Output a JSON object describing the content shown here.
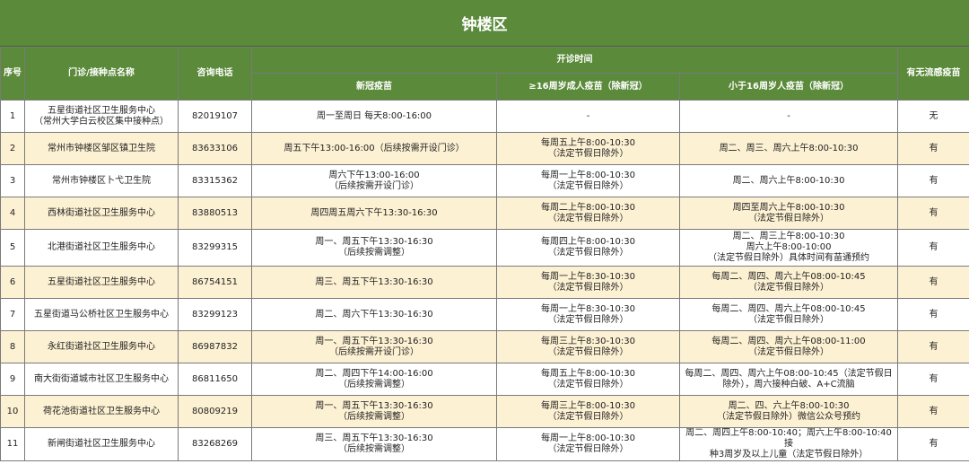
{
  "title": "钟楼区",
  "headers": {
    "seq": "序号",
    "name": "门诊/接种点名称",
    "phone": "咨询电话",
    "hours": "开诊时间",
    "covid": "新冠疫苗",
    "adult": "≥16周岁成人疫苗（除新冠）",
    "child": "小于16周岁人疫苗（除新冠）",
    "flu": "有无流感疫苗"
  },
  "rows": [
    {
      "seq": "1",
      "name": [
        "五星街道社区卫生服务中心",
        "（常州大学白云校区集中接种点）"
      ],
      "phone": "82019107",
      "covid": [
        "周一至周日 每天8:00-16:00"
      ],
      "adult": [
        "-"
      ],
      "child": [
        "-"
      ],
      "flu": "无"
    },
    {
      "seq": "2",
      "name": [
        "常州市钟楼区邹区镇卫生院"
      ],
      "phone": "83633106",
      "covid": [
        "周五下午13:00-16:00（后续按需开设门诊）"
      ],
      "adult": [
        "每周五上午8:00-10:30",
        "（法定节假日除外）"
      ],
      "child": [
        "周二、周三、周六上午8:00-10:30"
      ],
      "flu": "有"
    },
    {
      "seq": "3",
      "name": [
        "常州市钟楼区卜弋卫生院"
      ],
      "phone": "83315362",
      "covid": [
        "周六下午13:00-16:00",
        "（后续按需开设门诊）"
      ],
      "adult": [
        "每周一上午8:00-10:30",
        "（法定节假日除外）"
      ],
      "child": [
        "周二、周六上午8:00-10:30"
      ],
      "flu": "有"
    },
    {
      "seq": "4",
      "name": [
        "西林街道社区卫生服务中心"
      ],
      "phone": "83880513",
      "covid": [
        "周四周五周六下午13:30-16:30"
      ],
      "adult": [
        "每周二上午8:00-10:30",
        "（法定节假日除外）"
      ],
      "child": [
        "周四至周六上午8:00-10:30",
        "（法定节假日除外）"
      ],
      "flu": "有"
    },
    {
      "seq": "5",
      "name": [
        "北港街道社区卫生服务中心"
      ],
      "phone": "83299315",
      "covid": [
        "周一、周五下午13:30-16:30",
        "（后续按需调整）"
      ],
      "adult": [
        "每周四上午8:00-10:30",
        "（法定节假日除外）"
      ],
      "child": [
        "周二、周三上午8:00-10:30",
        "周六上午8:00-10:00",
        "（法定节假日除外）具体时间有苗通预约"
      ],
      "flu": "有"
    },
    {
      "seq": "6",
      "name": [
        "五星街道社区卫生服务中心"
      ],
      "phone": "86754151",
      "covid": [
        "周三、周五下午13:30-16:30"
      ],
      "adult": [
        "每周一上午8:30-10:30",
        "（法定节假日除外）"
      ],
      "child": [
        "每周二、周四、周六上午08:00-10:45",
        "（法定节假日除外）"
      ],
      "flu": "有"
    },
    {
      "seq": "7",
      "name": [
        "五星街道马公桥社区卫生服务中心"
      ],
      "phone": "83299123",
      "covid": [
        "周二、周六下午13:30-16:30"
      ],
      "adult": [
        "每周一上午8:30-10:30",
        "（法定节假日除外）"
      ],
      "child": [
        "每周二、周四、周六上午08:00-10:45",
        "（法定节假日除外）"
      ],
      "flu": "有"
    },
    {
      "seq": "8",
      "name": [
        "永红街道社区卫生服务中心"
      ],
      "phone": "86987832",
      "covid": [
        "周一、周五下午13:30-16:30",
        "（后续按需开设门诊）"
      ],
      "adult": [
        "每周三上午8:30-10:30",
        "（法定节假日除外）"
      ],
      "child": [
        "每周二、周四、周六上午08:00-11:00",
        "（法定节假日除外）"
      ],
      "flu": "有"
    },
    {
      "seq": "9",
      "name": [
        "南大街街道城市社区卫生服务中心"
      ],
      "phone": "86811650",
      "covid": [
        "周二、周四下午14:00-16:00",
        "（后续按需调整）"
      ],
      "adult": [
        "每周五上午8:00-10:30",
        "（法定节假日除外）"
      ],
      "child": [
        "每周二、周四、周六上午08:00-10:45（法定节假日",
        "除外），周六接种白破、A+C流脑"
      ],
      "flu": "有"
    },
    {
      "seq": "10",
      "name": [
        "荷花池街道社区卫生服务中心"
      ],
      "phone": "80809219",
      "covid": [
        "周一、周五下午13:30-16:30",
        "（后续按需调整）"
      ],
      "adult": [
        "每周三上午8:00-10:30",
        "（法定节假日除外）"
      ],
      "child": [
        "周二、四、六上午8:00-10:30",
        "（法定节假日除外）微信公众号预约"
      ],
      "flu": "有"
    },
    {
      "seq": "11",
      "name": [
        "新闸街道社区卫生服务中心"
      ],
      "phone": "83268269",
      "covid": [
        "周三、周五下午13:30-16:30",
        "（后续按需调整）"
      ],
      "adult": [
        "每周一上午8:00-10:30",
        "（法定节假日除外）"
      ],
      "child": [
        "周二、周四上午8:00-10:40；周六上午8:00-10:40接",
        "种3周岁及以上儿童（法定节假日除外）"
      ],
      "flu": "有"
    }
  ]
}
